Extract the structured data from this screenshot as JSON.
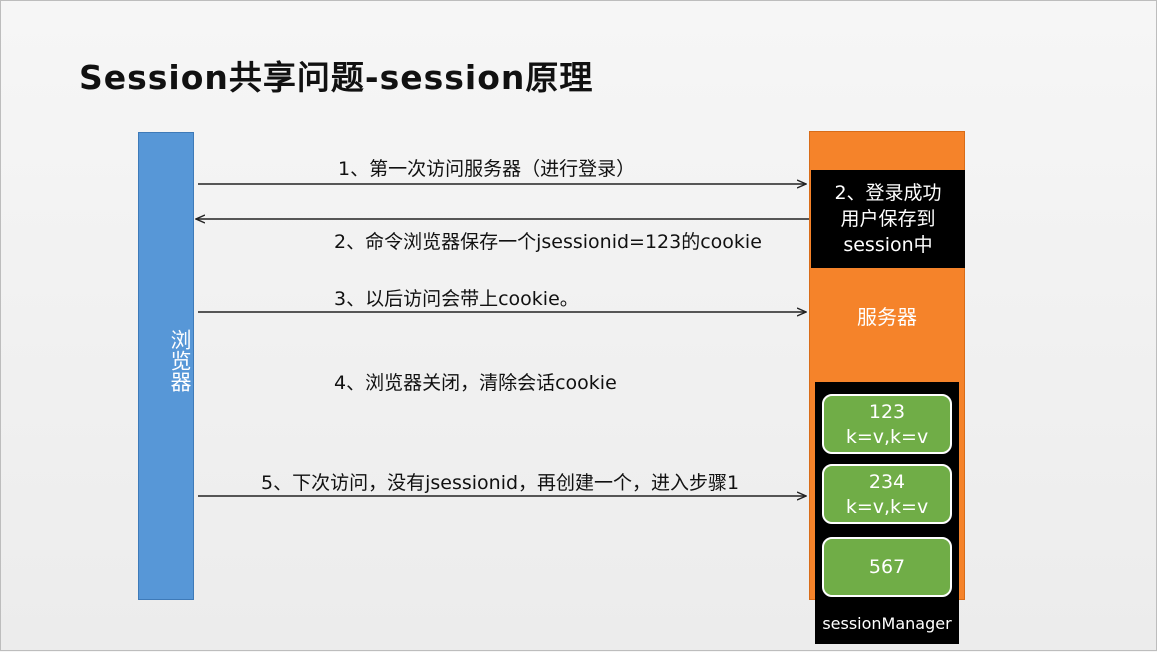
{
  "title": "Session共享问题-session原理",
  "browser": {
    "label": "浏览器"
  },
  "server": {
    "label": "服务器",
    "login_box": {
      "line1": "2、登录成功",
      "line2": "用户保存到",
      "line3": "session中"
    }
  },
  "session_manager": {
    "label": "sessionManager",
    "items": [
      {
        "id": "123",
        "data": "k=v,k=v"
      },
      {
        "id": "234",
        "data": "k=v,k=v"
      },
      {
        "id": "567",
        "data": ""
      }
    ]
  },
  "steps": [
    {
      "text": "1、第一次访问服务器（进行登录）",
      "direction": "to-server"
    },
    {
      "text": "2、命令浏览器保存一个jsessionid=123的cookie",
      "direction": "to-browser"
    },
    {
      "text": "3、以后访问会带上cookie。",
      "direction": "to-server"
    },
    {
      "text": "4、浏览器关闭，清除会话cookie",
      "direction": "none"
    },
    {
      "text": "5、下次访问，没有jsessionid，再创建一个，进入步骤1",
      "direction": "to-server"
    }
  ],
  "colors": {
    "browser": "#5797d7",
    "server": "#f5832a",
    "session_item": "#70ad47",
    "manager_bg": "#000000"
  }
}
